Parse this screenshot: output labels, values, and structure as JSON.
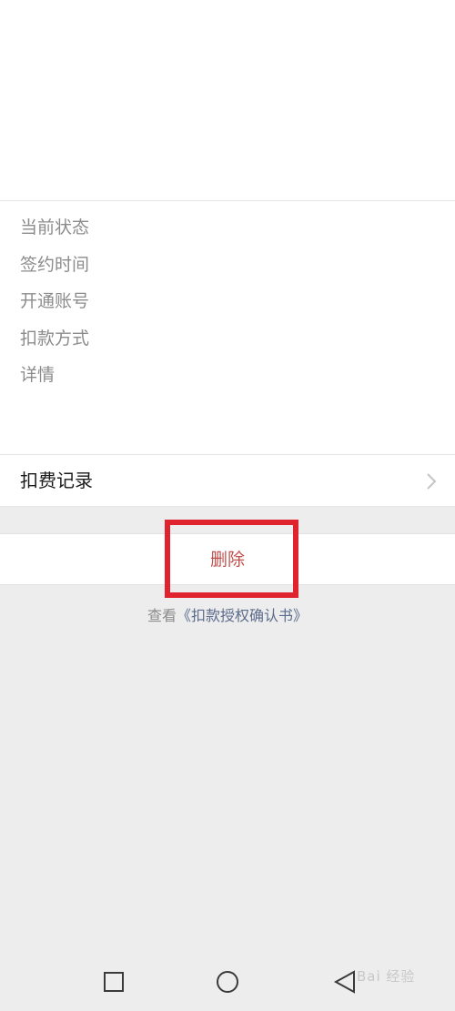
{
  "details": {
    "rows": [
      "当前状态",
      "签约时间",
      "开通账号",
      "扣款方式",
      "详情"
    ]
  },
  "record": {
    "label": "扣费记录"
  },
  "delete": {
    "label": "删除"
  },
  "auth": {
    "prefix": "查看",
    "link": "《扣款授权确认书》"
  },
  "nav": {
    "icons": [
      "square-icon",
      "circle-icon",
      "triangle-back-icon"
    ]
  },
  "watermark": {
    "text": "Bai 经验"
  },
  "colors": {
    "delete_text": "#c0504d",
    "highlight_border": "#e0242f",
    "link": "#5b6b8c",
    "background": "#ededed"
  }
}
